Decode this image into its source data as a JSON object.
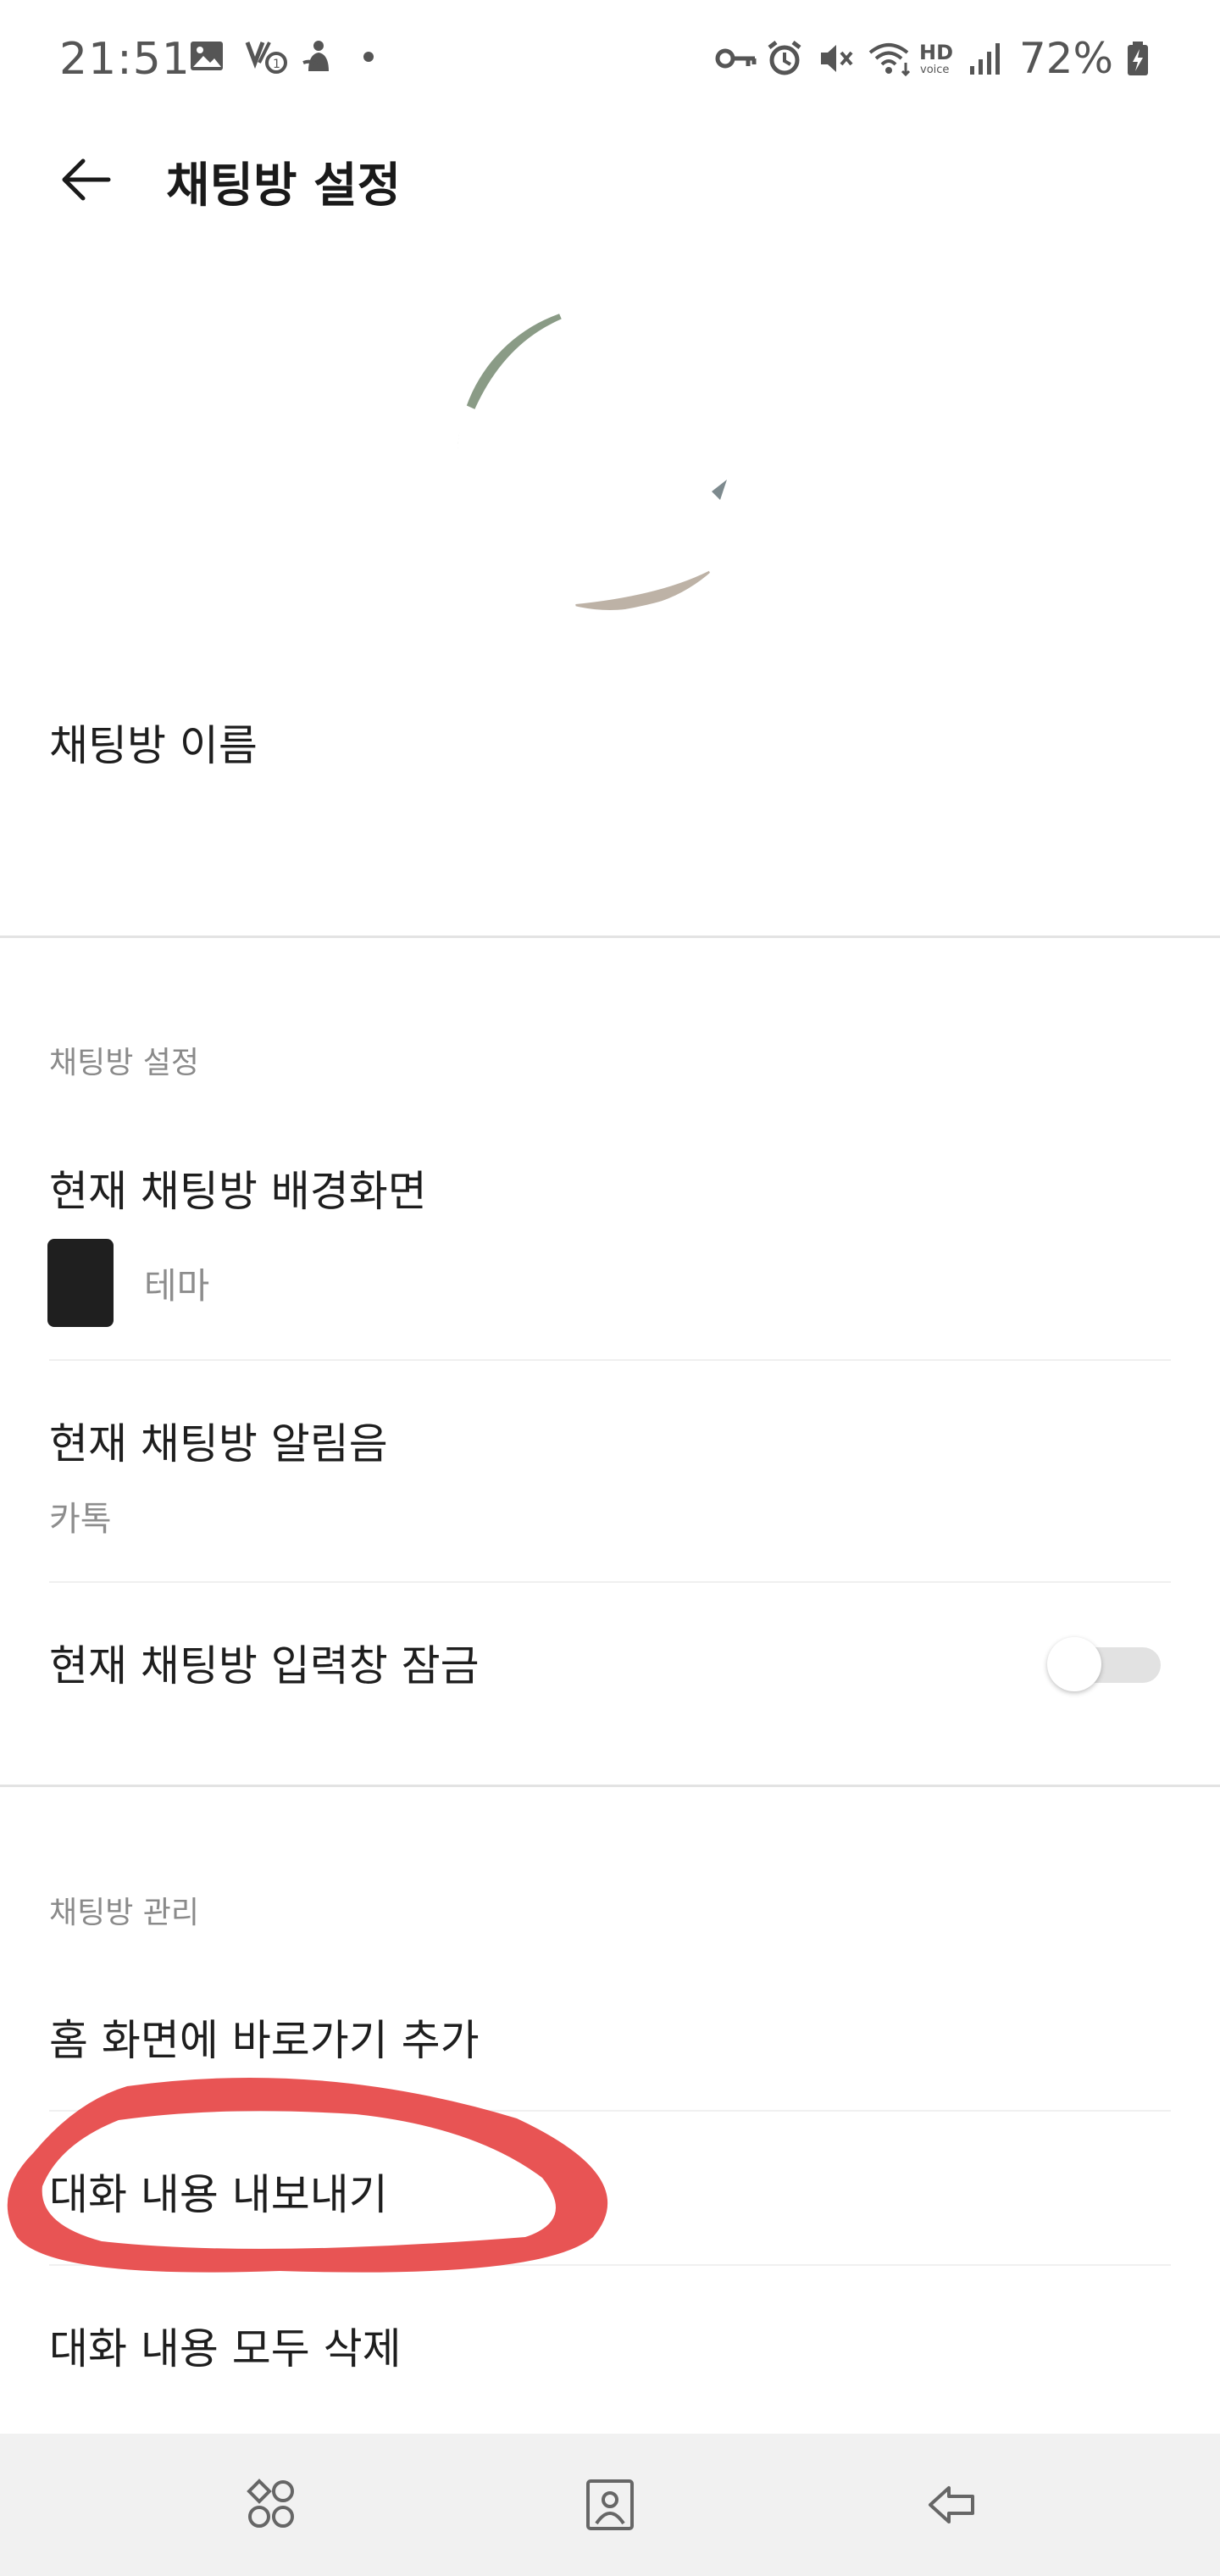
{
  "status_bar": {
    "time": "21:51",
    "battery": "72%",
    "left_icons": [
      "gallery-icon",
      "volte-icon",
      "app-notification-icon",
      "dot-icon"
    ],
    "right_icons": [
      "vpn-key-icon",
      "alarm-icon",
      "mute-icon",
      "wifi-icon",
      "hd-voice-icon",
      "signal-icon",
      "battery-charging-icon"
    ]
  },
  "header": {
    "title": "채팅방 설정"
  },
  "profile": {
    "chat_name_label": "채팅방 이름"
  },
  "section_chat_settings": {
    "label": "채팅방 설정",
    "background": {
      "title": "현재 채팅방 배경화면",
      "value": "테마"
    },
    "sound": {
      "title": "현재 채팅방 알림음",
      "value": "카톡"
    },
    "input_lock": {
      "title": "현재 채팅방 입력창 잠금",
      "enabled": false
    }
  },
  "section_chat_manage": {
    "label": "채팅방 관리",
    "items": [
      {
        "label": "홈 화면에 바로가기 추가"
      },
      {
        "label": "대화 내용 내보내기"
      },
      {
        "label": "대화 내용 모두 삭제"
      }
    ]
  },
  "annotation": {
    "highlight_color": "#e85454",
    "highlighted_item": "대화 내용 내보내기"
  },
  "nav_bar": {
    "buttons": [
      "recent-apps-icon",
      "home-icon",
      "back-icon"
    ]
  },
  "colors": {
    "background": "#ffffff",
    "divider": "#e3e3e3",
    "secondary_text": "#8d8d8d",
    "nav_bar": "#f1f1f1"
  }
}
